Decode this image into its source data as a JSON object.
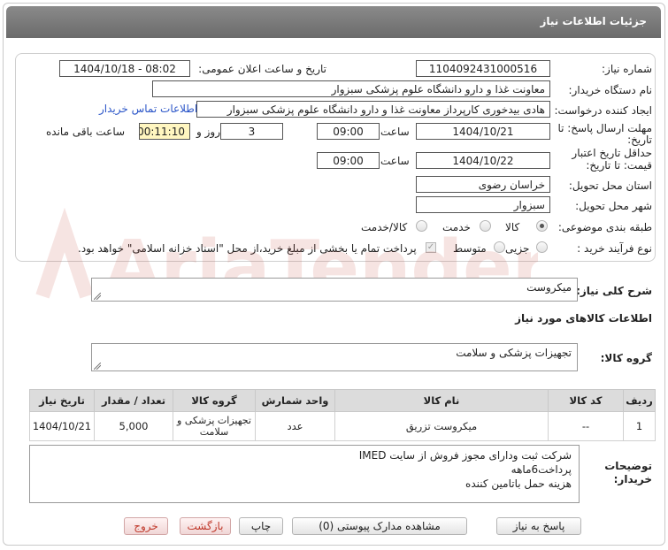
{
  "header": {
    "title": "جزئیات اطلاعات نیاز"
  },
  "form": {
    "need_number_label": "شماره نیاز:",
    "need_number": "1104092431000516",
    "announce_label": "تاریخ و ساعت اعلان عمومی:",
    "announce_value": "1404/10/18 - 08:02",
    "buyer_label": "نام دستگاه خریدار:",
    "buyer_value": "معاونت غذا و دارو   دانشگاه علوم پزشکی سبزوار",
    "creator_label": "ایجاد کننده درخواست:",
    "creator_value": "هادی بیدخوری کارپرداز معاونت غذا و دارو   دانشگاه علوم پزشکی سبزوار",
    "contact_link": "اطلاعات تماس خریدار",
    "deadline_label_1": "مهلت ارسال پاسخ: تا",
    "deadline_label_2": "تاریخ:",
    "deadline_date": "1404/10/21",
    "time_label": "ساعت",
    "deadline_time": "09:00",
    "days_value": "3",
    "days_label": "روز و",
    "remaining_time": "00:11:10",
    "remaining_label": "ساعت باقی مانده",
    "validity_label_1": "حداقل تاریخ اعتبار",
    "validity_label_2": "قیمت: تا تاریخ:",
    "validity_date": "1404/10/22",
    "validity_time": "09:00",
    "province_label": "استان محل تحویل:",
    "province_value": "خراسان رضوی",
    "city_label": "شهر محل تحویل:",
    "city_value": "سبزوار",
    "category_label": "طبقه بندی موضوعی:",
    "category_options": [
      "کالا",
      "خدمت",
      "کالا/خدمت"
    ],
    "category_selected": "کالا",
    "process_label": "نوع فرآیند خرید :",
    "process_options": [
      "جزیی",
      "متوسط"
    ],
    "payment_text": "پرداخت تمام یا بخشی از مبلغ خرید،از محل \"اسناد خزانه اسلامی\" خواهد بود."
  },
  "general_desc": {
    "label": "شرح کلی نیاز:",
    "value": "میکروست"
  },
  "goods_info_title": "اطلاعات کالاهای مورد نیاز",
  "goods_group": {
    "label": "گروه کالا:",
    "value": "تجهیزات پزشکی و سلامت"
  },
  "table": {
    "headers": [
      "ردیف",
      "کد کالا",
      "نام کالا",
      "واحد شمارش",
      "گروه کالا",
      "تعداد / مقدار",
      "تاریخ نیاز"
    ],
    "rows": [
      [
        "1",
        "--",
        "میکروست تزریق",
        "عدد",
        "تجهیزات پزشکی و سلامت",
        "5,000",
        "1404/10/21"
      ]
    ]
  },
  "buyer_notes": {
    "label_1": "توضیحات",
    "label_2": "خریدار:",
    "lines": [
      "شرکت ثبت ودارای مجوز فروش از سایت IMED",
      "پرداخت6ماهه",
      "هزینه حمل باتامین کننده"
    ]
  },
  "buttons": {
    "reply": "پاسخ به نیاز",
    "attachments": "مشاهده مدارک پیوستی (0)",
    "print": "چاپ",
    "back": "بازگشت",
    "exit": "خروج"
  },
  "watermark": {
    "text": "AriaTender.net"
  },
  "colors": {
    "header": "#7a7a7a",
    "link": "#2a55c8",
    "remaining_bg": "#fff6c0",
    "watermark": "#c0392b"
  }
}
